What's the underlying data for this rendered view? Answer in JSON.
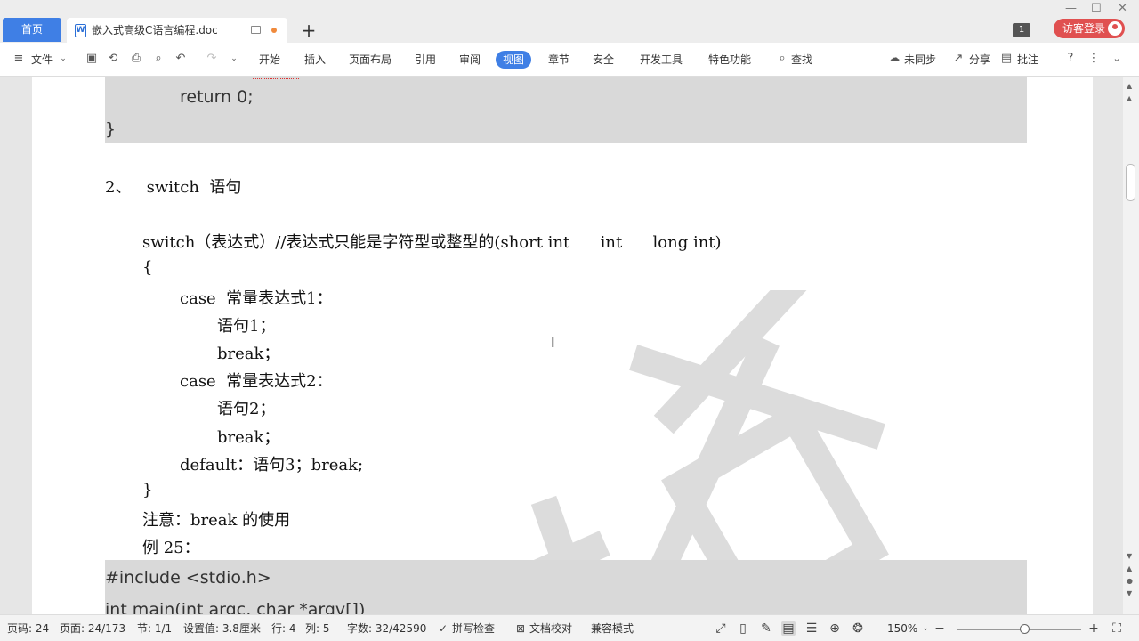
{
  "tabs": {
    "home": "首页",
    "doc_title": "嵌入式高级C语言编程.doc",
    "add": "+"
  },
  "window": {
    "page_badge": "1",
    "login": "访客登录"
  },
  "toolbar": {
    "file_menu": "文件",
    "tabs": [
      "开始",
      "插入",
      "页面布局",
      "引用",
      "审阅",
      "视图",
      "章节",
      "安全",
      "开发工具",
      "特色功能"
    ],
    "active_tab": "视图",
    "search": "查找",
    "sync": "未同步",
    "share": "分享",
    "comment": "批注"
  },
  "document": {
    "code_top": [
      "return 0;",
      "}"
    ],
    "heading": "2、   switch  语句",
    "lines": [
      "switch（表达式）//表达式只能是字符型或整型的(short int      int      long int)",
      "{",
      "case  常量表达式1：",
      "语句1；",
      "break；",
      "case  常量表达式2：",
      "语句2；",
      "break；",
      "default：语句3；break;",
      "}",
      "注意：break 的使用",
      "例 25："
    ],
    "code_bottom": [
      "#include <stdio.h>",
      "int main(int argc, char *argv[])"
    ]
  },
  "statusbar": {
    "page_code": "页码: 24",
    "page": "页面: 24/173",
    "section": "节: 1/1",
    "setting": "设置值: 3.8厘米",
    "row": "行: 4",
    "col": "列: 5",
    "words": "字数: 32/42590",
    "spell": "拼写检查",
    "proof": "文档校对",
    "compat": "兼容模式",
    "zoom": "150%",
    "zoom_fraction": 0.54
  },
  "colors": {
    "accent": "#3f7fe5",
    "login": "#e05050",
    "code_bg": "#d9d9d9"
  }
}
